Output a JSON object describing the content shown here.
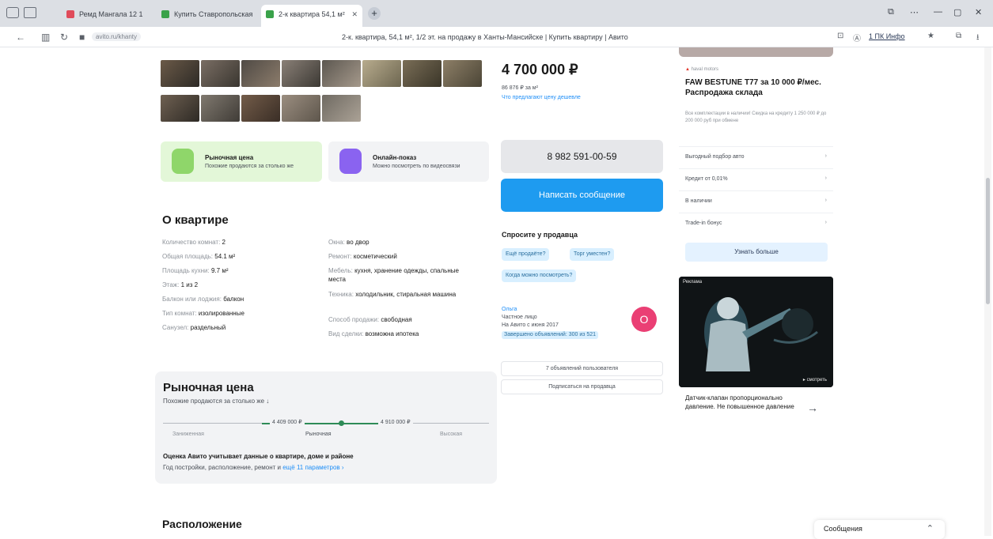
{
  "browser": {
    "tabs": [
      {
        "label": "Ремд Мангала 12 1",
        "active": false
      },
      {
        "label": "Купить Ставропольская",
        "active": false
      },
      {
        "label": "2-к квартира 54,1 м²",
        "active": true
      }
    ],
    "url_chip": "avito.ru/khanty",
    "page_title": "2-к. квартира, 54,1 м², 1/2 эт. на продажу в Ханты-Мансийске | Купить квартиру | Авито",
    "downloads_label": "1 ПК Инфо"
  },
  "listing": {
    "price": "4 700 000 ₽",
    "price_per_m": "86 876 ₽ за м²",
    "price_history_link": "Что предлагают цену дешевле",
    "phone": "8 982 591-00-59",
    "write_label": "Написать сообщение",
    "ask_title": "Спросите у продавца",
    "ask_chips": [
      "Ещё продаёте?",
      "Торг уместен?",
      "Когда можно посмотреть?"
    ],
    "seller": {
      "name": "Ольга",
      "type": "Частное лицо",
      "since": "На Авито с июня 2017",
      "badge": "Завершено объявлений: 300 из 521"
    },
    "subscribe_label": "7 объявлений пользователя",
    "notify_label": "Подписаться на продавца"
  },
  "features": [
    {
      "title": "Рыночная цена",
      "subtitle": "Похожие продаются за столько же"
    },
    {
      "title": "Онлайн-показ",
      "subtitle": "Можно посмотреть по видеосвязи"
    }
  ],
  "about": {
    "title": "О квартире",
    "left": [
      {
        "k": "Количество комнат:",
        "v": "2"
      },
      {
        "k": "Общая площадь:",
        "v": "54.1 м²"
      },
      {
        "k": "Площадь кухни:",
        "v": "9.7 м²"
      },
      {
        "k": "Этаж:",
        "v": "1 из 2"
      },
      {
        "k": "Балкон или лоджия:",
        "v": "балкон"
      },
      {
        "k": "Тип комнат:",
        "v": "изолированные"
      },
      {
        "k": "Санузел:",
        "v": "раздельный"
      }
    ],
    "right": [
      {
        "k": "Окна:",
        "v": "во двор"
      },
      {
        "k": "Ремонт:",
        "v": "косметический"
      },
      {
        "k": "Мебель:",
        "v": "кухня, хранение одежды, спальные места"
      },
      {
        "k": "Техника:",
        "v": "холодильник, стиральная машина"
      },
      {
        "k": "Способ продажи:",
        "v": "свободная"
      },
      {
        "k": "Вид сделки:",
        "v": "возможна ипотека"
      }
    ]
  },
  "market": {
    "title": "Рыночная цена",
    "subtitle": "Похожие продаются за столько же ↓",
    "low_price": "4 409 000 ₽",
    "high_price": "4 910 000 ₽",
    "scale_labels": [
      "Заниженная",
      "Рыночная",
      "Высокая"
    ],
    "note": "Оценка Авито учитывает данные о квартире, доме и районе",
    "note2": "Год постройки, расположение, ремонт и ",
    "note2_link": "ещё 11 параметров ›"
  },
  "location_title": "Расположение",
  "ad": {
    "brand": "haval motors",
    "title": "FAW BESTUNE T77 за 10 000 ₽/мес. Распродажа склада",
    "text": "Все комплектации в наличии! Скидка на кредиту 1 250 000 ₽ до 200 000 руб при обмене",
    "rows": [
      "Выгодный подбор авто",
      "Кредит от 0,01%",
      "В наличии",
      "Trade-in бонус"
    ],
    "button": "Узнать больше",
    "video_tag": "Реклама",
    "video_badge": "▸ смотреть",
    "caption": "Датчик-клапан пропорционально давление. Не повышенное давление",
    "arrow": "→"
  },
  "messenger_label": "Сообщения",
  "colors": {
    "accent_blue": "#1e9bf0",
    "market_green": "#2e8b57",
    "avatar_pink": "#ea3f74"
  }
}
